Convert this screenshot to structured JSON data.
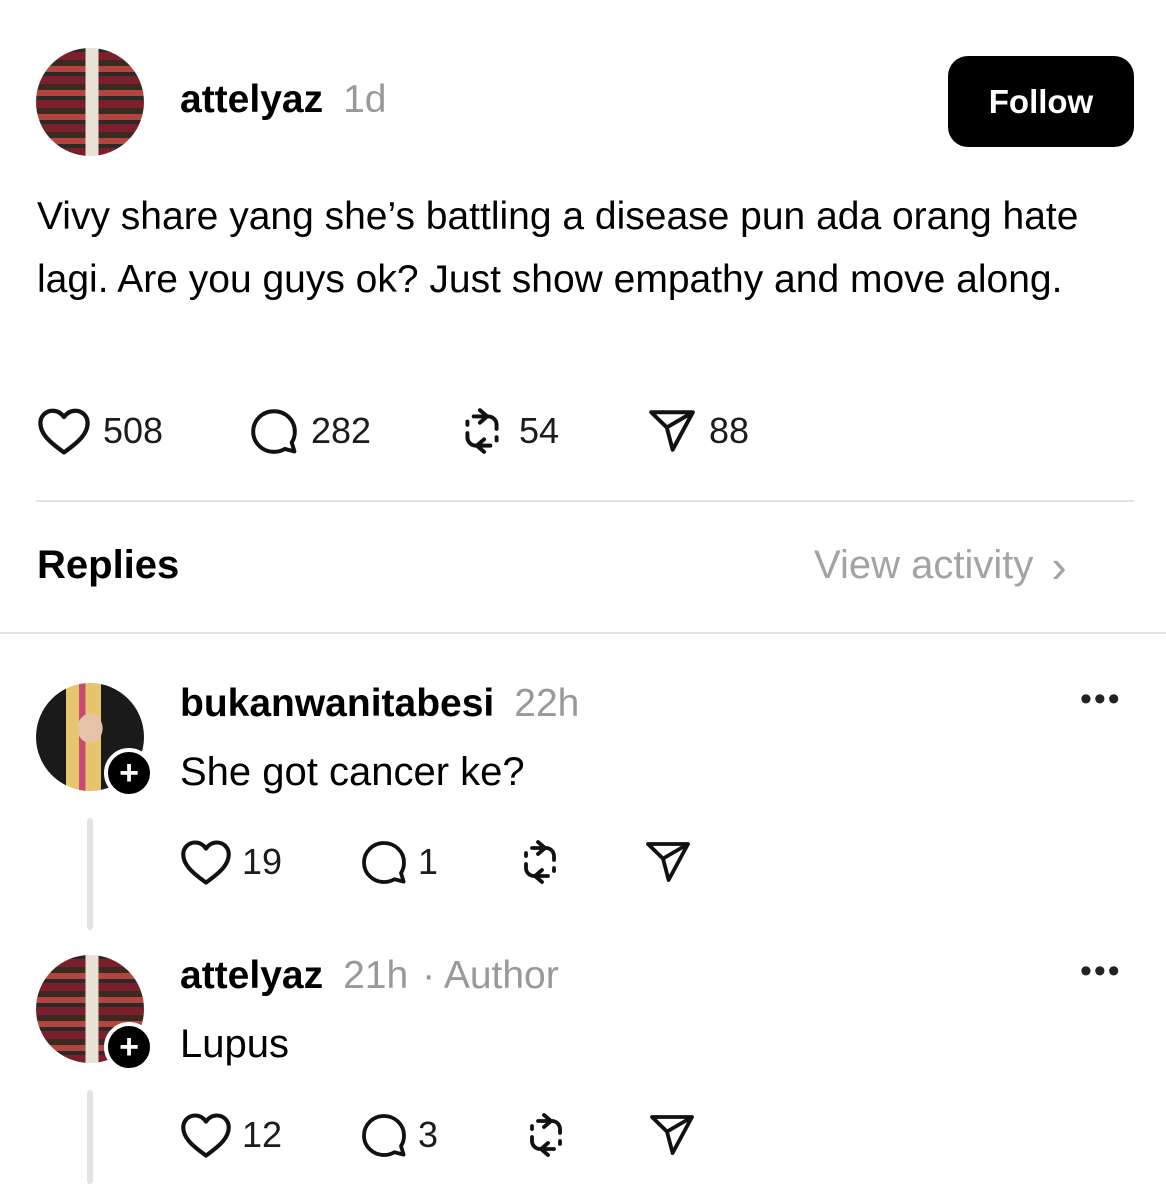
{
  "post": {
    "username": "attelyaz",
    "time": "1d",
    "follow_label": "Follow",
    "text": "Vivy share yang she’s battling a disease pun ada orang hate lagi. Are you guys ok? Just show empathy and move along.",
    "stats": {
      "likes": "508",
      "replies": "282",
      "reposts": "54",
      "shares": "88"
    }
  },
  "replies_header": {
    "title": "Replies",
    "view_activity": "View activity",
    "chevron": "›"
  },
  "replies": [
    {
      "username": "bukanwanitabesi",
      "time": "22h",
      "author_tag": "",
      "text": "She got cancer ke?",
      "stats": {
        "likes": "19",
        "replies": "1"
      }
    },
    {
      "username": "attelyaz",
      "time": "21h",
      "author_tag": "· Author",
      "text": "Lupus",
      "stats": {
        "likes": "12",
        "replies": "3"
      }
    }
  ],
  "icons": {
    "like": "heart-icon",
    "reply": "comment-bubble-icon",
    "repost": "repost-icon",
    "share": "paper-plane-icon",
    "more": "more-options-icon",
    "add": "plus-icon"
  },
  "colors": {
    "text": "#000000",
    "muted": "#999999",
    "divider": "#e3e3e3",
    "button": "#000000"
  }
}
